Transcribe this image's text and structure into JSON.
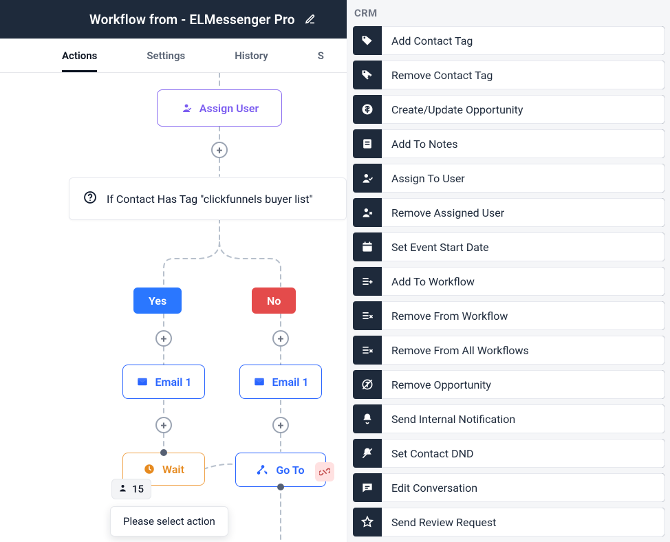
{
  "header": {
    "title": "Workflow from - ELMessenger Pro"
  },
  "tabs": {
    "items": [
      {
        "id": "actions",
        "label": "Actions",
        "active": true
      },
      {
        "id": "settings",
        "label": "Settings",
        "active": false
      },
      {
        "id": "history",
        "label": "History",
        "active": false
      },
      {
        "id": "s",
        "label": "S",
        "active": false
      }
    ]
  },
  "canvas": {
    "assign_user_label": "Assign User",
    "condition_text": "If Contact Has Tag \"clickfunnels buyer list\"",
    "yes_label": "Yes",
    "no_label": "No",
    "email1_label": "Email 1",
    "wait_label": "Wait",
    "goto_label": "Go To",
    "wait_count": "15",
    "tooltip_text": "Please select action"
  },
  "sidepanel": {
    "group_label": "CRM",
    "items": [
      {
        "icon": "tag",
        "label": "Add Contact Tag"
      },
      {
        "icon": "tag-x",
        "label": "Remove Contact Tag"
      },
      {
        "icon": "dollar",
        "label": "Create/Update Opportunity"
      },
      {
        "icon": "note",
        "label": "Add To Notes"
      },
      {
        "icon": "user-check",
        "label": "Assign To User"
      },
      {
        "icon": "user-x",
        "label": "Remove Assigned User"
      },
      {
        "icon": "calendar",
        "label": "Set Event Start Date"
      },
      {
        "icon": "list-plus",
        "label": "Add To Workflow"
      },
      {
        "icon": "list-x",
        "label": "Remove From Workflow"
      },
      {
        "icon": "list-x",
        "label": "Remove From All Workflows"
      },
      {
        "icon": "dollar-slash",
        "label": "Remove Opportunity"
      },
      {
        "icon": "bell",
        "label": "Send Internal Notification"
      },
      {
        "icon": "bell-slash",
        "label": "Set Contact DND"
      },
      {
        "icon": "chat",
        "label": "Edit Conversation"
      },
      {
        "icon": "star",
        "label": "Send Review Request"
      }
    ]
  }
}
